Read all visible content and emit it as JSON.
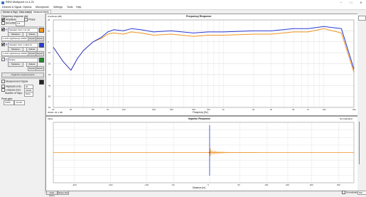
{
  "window": {
    "title": "REW Multipoint v1.4.23"
  },
  "menu": [
    "Devices & Signal",
    "Options",
    "Microphone",
    "Settings",
    "Tools",
    "Help"
  ],
  "tabs": [
    "Device & Signal",
    "Data analysis",
    "Measurements"
  ],
  "left": {
    "header": "Frequency response plot",
    "amplitude": "Amplitude",
    "phase": "Phase",
    "smoothing": "Smoothing",
    "smooth_val": "1/3",
    "trace1_name": "Speaker front L w/ cal",
    "trace2_name": "Speaker front L cable fix",
    "trace3_name": "Empty",
    "measure": "Measure",
    "delete": "Delete",
    "import": "Import",
    "export": "Export",
    "log_label": "L & R Log(Sweep) 44100",
    "organize": "Organize measurements",
    "meas_sig": "Measurement Signal",
    "highpass": "Highpass (Hz):",
    "lowpass": "Lowpass (Hz):",
    "taps": "Number of Taps:",
    "peak": "Peak gain:",
    "hp_val": "20",
    "lp_val": "20000",
    "taps_val": "8192",
    "peak_val": "0.000",
    "peak_val2": "-12.00"
  },
  "fr": {
    "title": "Frequency Response",
    "ylabel": "Amplitude [dB]",
    "xlabel": "Frequency [Hz]",
    "bottom": "20kHz  -61.1 dB",
    "yticks": [
      "20",
      "10",
      "0",
      "-10",
      "-20",
      "-30",
      "-40",
      "-50",
      "-60"
    ],
    "xticks": [
      "20",
      "30",
      "50",
      "70",
      "100",
      "200",
      "300",
      "500",
      "700",
      "1k",
      "2k",
      "3k",
      "5k",
      "7k",
      "10k",
      "20k"
    ]
  },
  "ir": {
    "title": "Impulse Response",
    "ylabel": "Value",
    "xlabel": "Distance [m]",
    "right_label": "Normalization",
    "xticks": [
      "-300",
      "-200",
      "-100",
      "-50",
      "0",
      "50",
      "100",
      "200",
      "300",
      "400"
    ]
  },
  "bottom": {
    "autozoom": "Auto Zoom",
    "zoomout": "Zoom Out",
    "normalize": "Normalization",
    "norm_val": "500"
  },
  "colors": {
    "blue": "#2a3bd6",
    "orange": "#f0941f",
    "red": "#d42020",
    "grid": "#d8d8d8"
  },
  "chart_data": {
    "type": "line",
    "title": "Frequency Response",
    "xlabel": "Frequency [Hz]",
    "ylabel": "Amplitude [dB]",
    "x": [
      20,
      25,
      30,
      35,
      40,
      50,
      60,
      70,
      80,
      100,
      120,
      150,
      200,
      300,
      500,
      700,
      1000,
      2000,
      3000,
      5000,
      7000,
      10000,
      15000,
      20000
    ],
    "series": [
      {
        "name": "Speaker front L w/ cal",
        "color": "#2a3bd6",
        "values": [
          -5,
          -18,
          -26,
          -15,
          -8,
          0,
          4,
          9,
          11,
          10,
          12,
          11,
          9,
          10,
          8,
          9,
          9,
          10,
          10,
          12,
          12,
          14,
          12,
          -25
        ]
      },
      {
        "name": "Speaker front L cable fix",
        "color": "#f0941f",
        "values": [
          -5,
          -18,
          -26,
          -15,
          -8,
          0,
          3,
          7,
          8,
          7,
          9,
          8,
          6,
          7,
          5,
          6,
          6,
          7,
          7,
          9,
          9,
          12,
          8,
          -28
        ]
      }
    ],
    "ylim": [
      -60,
      20
    ],
    "xscale": "log"
  }
}
